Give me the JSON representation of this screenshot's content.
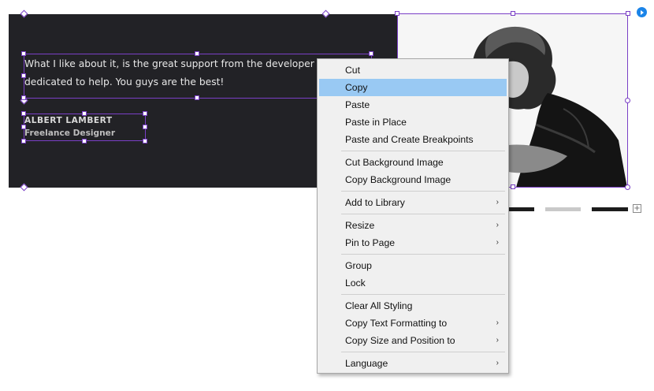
{
  "testimonial": {
    "quote": "What I like about it, is the great support from the developer team. They\ndedicated to help. You guys are the best!",
    "author_name": "ALBERT LAMBERT",
    "author_role": "Freelance Designer"
  },
  "slideshow": {
    "add_symbol": "+",
    "bar_colors": [
      "#1c1c1c",
      "#c9c9c9",
      "#1c1c1c"
    ]
  },
  "colors": {
    "selection": "#7a3fc6",
    "highlight": "#99c9f3",
    "dark_panel": "#222226",
    "play_button": "#1b84e8"
  },
  "context_menu": {
    "items": [
      {
        "label": "Cut",
        "submenu": false
      },
      {
        "label": "Copy",
        "submenu": false,
        "highlighted": true
      },
      {
        "label": "Paste",
        "submenu": false
      },
      {
        "label": "Paste in Place",
        "submenu": false
      },
      {
        "label": "Paste and Create Breakpoints",
        "submenu": false
      },
      {
        "label": "Cut Background Image",
        "submenu": false
      },
      {
        "label": "Copy Background Image",
        "submenu": false
      },
      {
        "label": "Add to Library",
        "submenu": true
      },
      {
        "label": "Resize",
        "submenu": true
      },
      {
        "label": "Pin to Page",
        "submenu": true
      },
      {
        "label": "Group",
        "submenu": false
      },
      {
        "label": "Lock",
        "submenu": false
      },
      {
        "label": "Clear All Styling",
        "submenu": false
      },
      {
        "label": "Copy Text Formatting to",
        "submenu": true
      },
      {
        "label": "Copy Size and Position to",
        "submenu": true
      },
      {
        "label": "Language",
        "submenu": true
      }
    ],
    "submenu_arrow": "›"
  }
}
